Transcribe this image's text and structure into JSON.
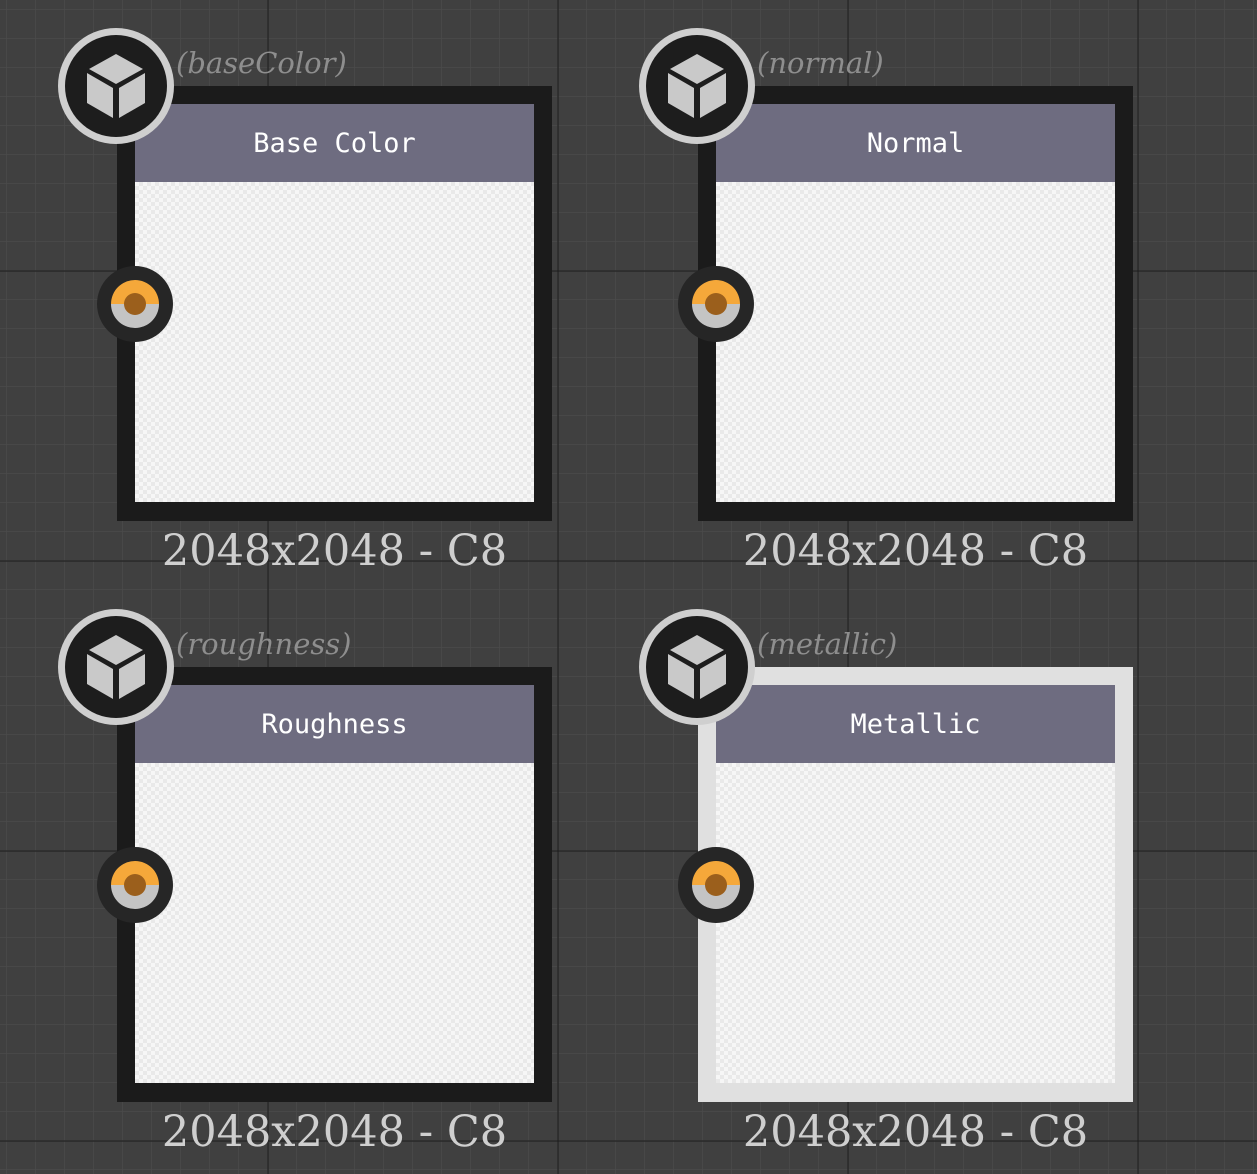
{
  "graph": {
    "nodes": [
      {
        "identifier": "(baseColor)",
        "label": "Base Color",
        "resolution": "2048x2048 - C8",
        "icon": "cube-icon",
        "selected": false
      },
      {
        "identifier": "(normal)",
        "label": "Normal",
        "resolution": "2048x2048 - C8",
        "icon": "cube-icon",
        "selected": false
      },
      {
        "identifier": "(roughness)",
        "label": "Roughness",
        "resolution": "2048x2048 - C8",
        "icon": "cube-icon",
        "selected": false
      },
      {
        "identifier": "(metallic)",
        "label": "Metallic",
        "resolution": "2048x2048 - C8",
        "icon": "cube-icon",
        "selected": true
      }
    ]
  },
  "colors": {
    "canvas": "#404040",
    "node_frame": "#1b1b1b",
    "node_frame_selected": "#e0e0e0",
    "header": "#6e6c80",
    "port_top": "#f5a83a",
    "port_bottom": "#c4c4c4",
    "port_center": "#9b5f1c"
  }
}
